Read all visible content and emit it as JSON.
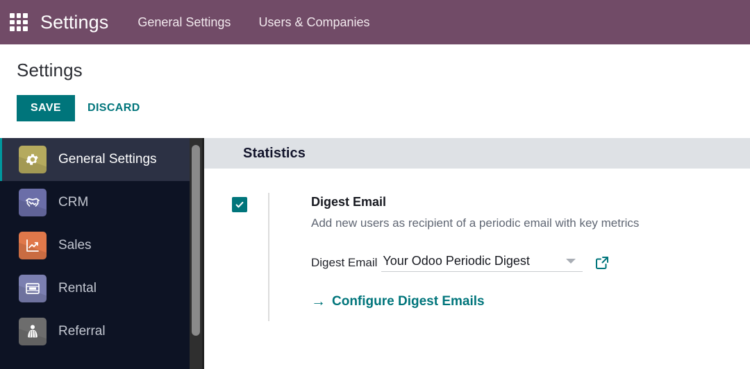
{
  "navbar": {
    "apps_icon": "apps-grid-icon",
    "brand": "Settings",
    "menu": [
      {
        "label": "General Settings"
      },
      {
        "label": "Users & Companies"
      }
    ],
    "color": "#714b67"
  },
  "control_panel": {
    "title": "Settings",
    "save_label": "SAVE",
    "discard_label": "DISCARD",
    "accent": "#00757b"
  },
  "sidebar": {
    "items": [
      {
        "label": "General Settings",
        "icon": "gear-icon",
        "color": "#b5aa5e",
        "active": true
      },
      {
        "label": "CRM",
        "icon": "handshake-icon",
        "color": "#6b6ea8",
        "active": false
      },
      {
        "label": "Sales",
        "icon": "chart-up-icon",
        "color": "#e0784a",
        "active": false
      },
      {
        "label": "Rental",
        "icon": "ticket-icon",
        "color": "#7b7fb0",
        "active": false
      },
      {
        "label": "Referral",
        "icon": "person-icon",
        "color": "#6d6d6d",
        "active": false
      }
    ]
  },
  "main": {
    "section_title": "Statistics",
    "setting": {
      "checked": true,
      "title": "Digest Email",
      "description": "Add new users as recipient of a periodic email with key metrics",
      "field_label": "Digest Email",
      "field_value": "Your Odoo Periodic Digest",
      "dropdown_icon": "chevron-down-icon",
      "external_link_icon": "external-link-icon",
      "action_arrow": "→",
      "action_label": "Configure Digest Emails"
    }
  }
}
